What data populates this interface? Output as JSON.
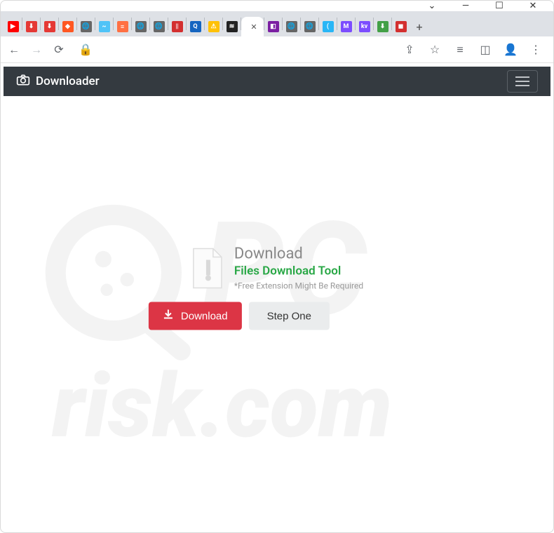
{
  "window": {
    "controls": {
      "dropdown": "⌄",
      "minimize": "—",
      "maximize": "☐",
      "close": "✕"
    }
  },
  "tabs": {
    "favicons": [
      {
        "bg": "#ff0000",
        "txt": "▶"
      },
      {
        "bg": "#e53935",
        "txt": "⬇"
      },
      {
        "bg": "#e53935",
        "txt": "⬇"
      },
      {
        "bg": "#ff5722",
        "txt": "◆"
      },
      {
        "bg": "#666",
        "txt": "🌐"
      },
      {
        "bg": "#4fc3f7",
        "txt": "~"
      },
      {
        "bg": "#ff7043",
        "txt": "≡"
      },
      {
        "bg": "#666",
        "txt": "🌐"
      },
      {
        "bg": "#666",
        "txt": "🌐"
      },
      {
        "bg": "#d32f2f",
        "txt": "||"
      },
      {
        "bg": "#1565c0",
        "txt": "Q"
      },
      {
        "bg": "#ffc107",
        "txt": "⚠"
      },
      {
        "bg": "#222",
        "txt": "≋"
      }
    ],
    "active": {
      "close": "✕"
    },
    "after": [
      {
        "bg": "#7b1fa2",
        "txt": "◧"
      },
      {
        "bg": "#666",
        "txt": "🌐"
      },
      {
        "bg": "#666",
        "txt": "🌐"
      },
      {
        "bg": "#29b6f6",
        "txt": "("
      },
      {
        "bg": "#7c4dff",
        "txt": "M"
      },
      {
        "bg": "#7c4dff",
        "txt": "kv"
      },
      {
        "bg": "#43a047",
        "txt": "⬇"
      },
      {
        "bg": "#d32f2f",
        "txt": "◼"
      }
    ],
    "new_tab": "+"
  },
  "toolbar": {
    "back": "←",
    "forward": "→",
    "reload": "⟳",
    "lock": "🔒",
    "share": "⇪",
    "star": "☆",
    "list": "≡",
    "panel": "◫",
    "profile": "👤",
    "menu": "⋮"
  },
  "header": {
    "brand": "Downloader"
  },
  "main": {
    "title": "Download",
    "subtitle": "Files Download Tool",
    "note": "*Free Extension Might Be Required",
    "download_button": "Download",
    "step_button": "Step One"
  },
  "watermark": {
    "top": "PC",
    "bottom": "risk.com"
  }
}
